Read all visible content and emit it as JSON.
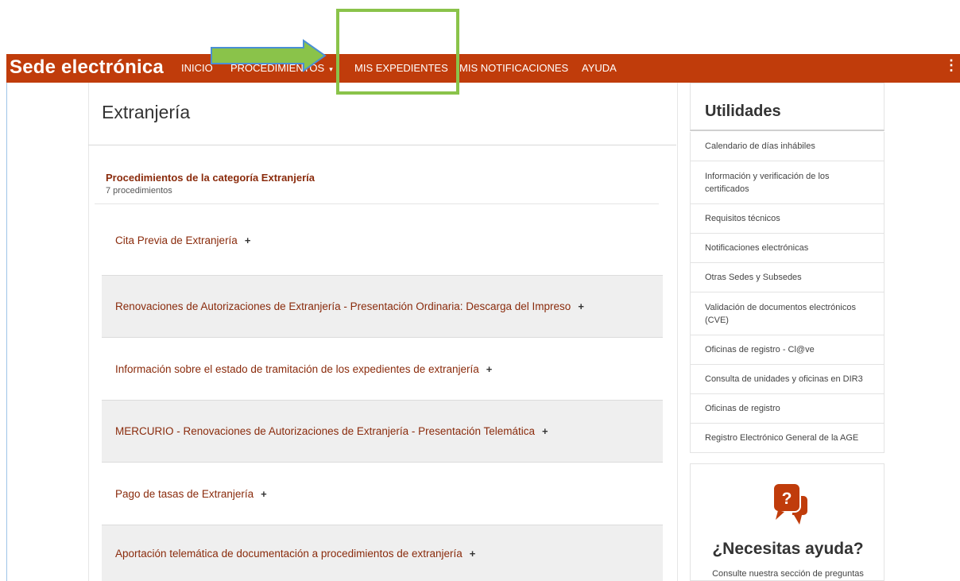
{
  "header": {
    "brand": "Sede electrónica",
    "nav": [
      {
        "label": "INICIO"
      },
      {
        "label": "PROCEDIMIENTOS"
      },
      {
        "label": "MIS EXPEDIENTES"
      },
      {
        "label": "MIS NOTIFICACIONES"
      },
      {
        "label": "AYUDA"
      }
    ],
    "dropdown_caret": "▾",
    "menu_glyph": "⋮"
  },
  "main": {
    "title": "Extranjería",
    "category_title": "Procedimientos de la categoría Extranjería",
    "category_count": "7 procedimientos",
    "expand_glyph": "+",
    "procedures": [
      {
        "label": "Cita Previa de Extranjería"
      },
      {
        "label": "Renovaciones de Autorizaciones de Extranjería - Presentación Ordinaria: Descarga del Impreso"
      },
      {
        "label": "Información sobre el estado de tramitación de los expedientes de extranjería"
      },
      {
        "label": "MERCURIO - Renovaciones de Autorizaciones de Extranjería - Presentación Telemática"
      },
      {
        "label": "Pago de tasas de Extranjería"
      },
      {
        "label": "Aportación telemática de documentación a procedimientos de extranjería"
      }
    ]
  },
  "sidebar": {
    "title": "Utilidades",
    "items": [
      {
        "label": "Calendario de días inhábiles"
      },
      {
        "label": "Información y verificación de los certificados"
      },
      {
        "label": "Requisitos técnicos"
      },
      {
        "label": "Notificaciones electrónicas"
      },
      {
        "label": "Otras Sedes y Subsedes"
      },
      {
        "label": "Validación de documentos electrónicos (CVE)"
      },
      {
        "label": "Oficinas de registro - Cl@ve"
      },
      {
        "label": "Consulta de unidades y oficinas en DIR3"
      },
      {
        "label": "Oficinas de registro"
      },
      {
        "label": "Registro Electrónico General de la AGE"
      }
    ],
    "help_title": "¿Necesitas ayuda?",
    "help_text": "Consulte nuestra sección de preguntas",
    "help_icon_glyph": "?"
  },
  "colors": {
    "brand_bar": "#c03c0b",
    "link": "#8a2b0c",
    "highlight": "#8ac34a",
    "arrow_fill": "#8ac34a",
    "arrow_stroke": "#4a8fd4"
  }
}
